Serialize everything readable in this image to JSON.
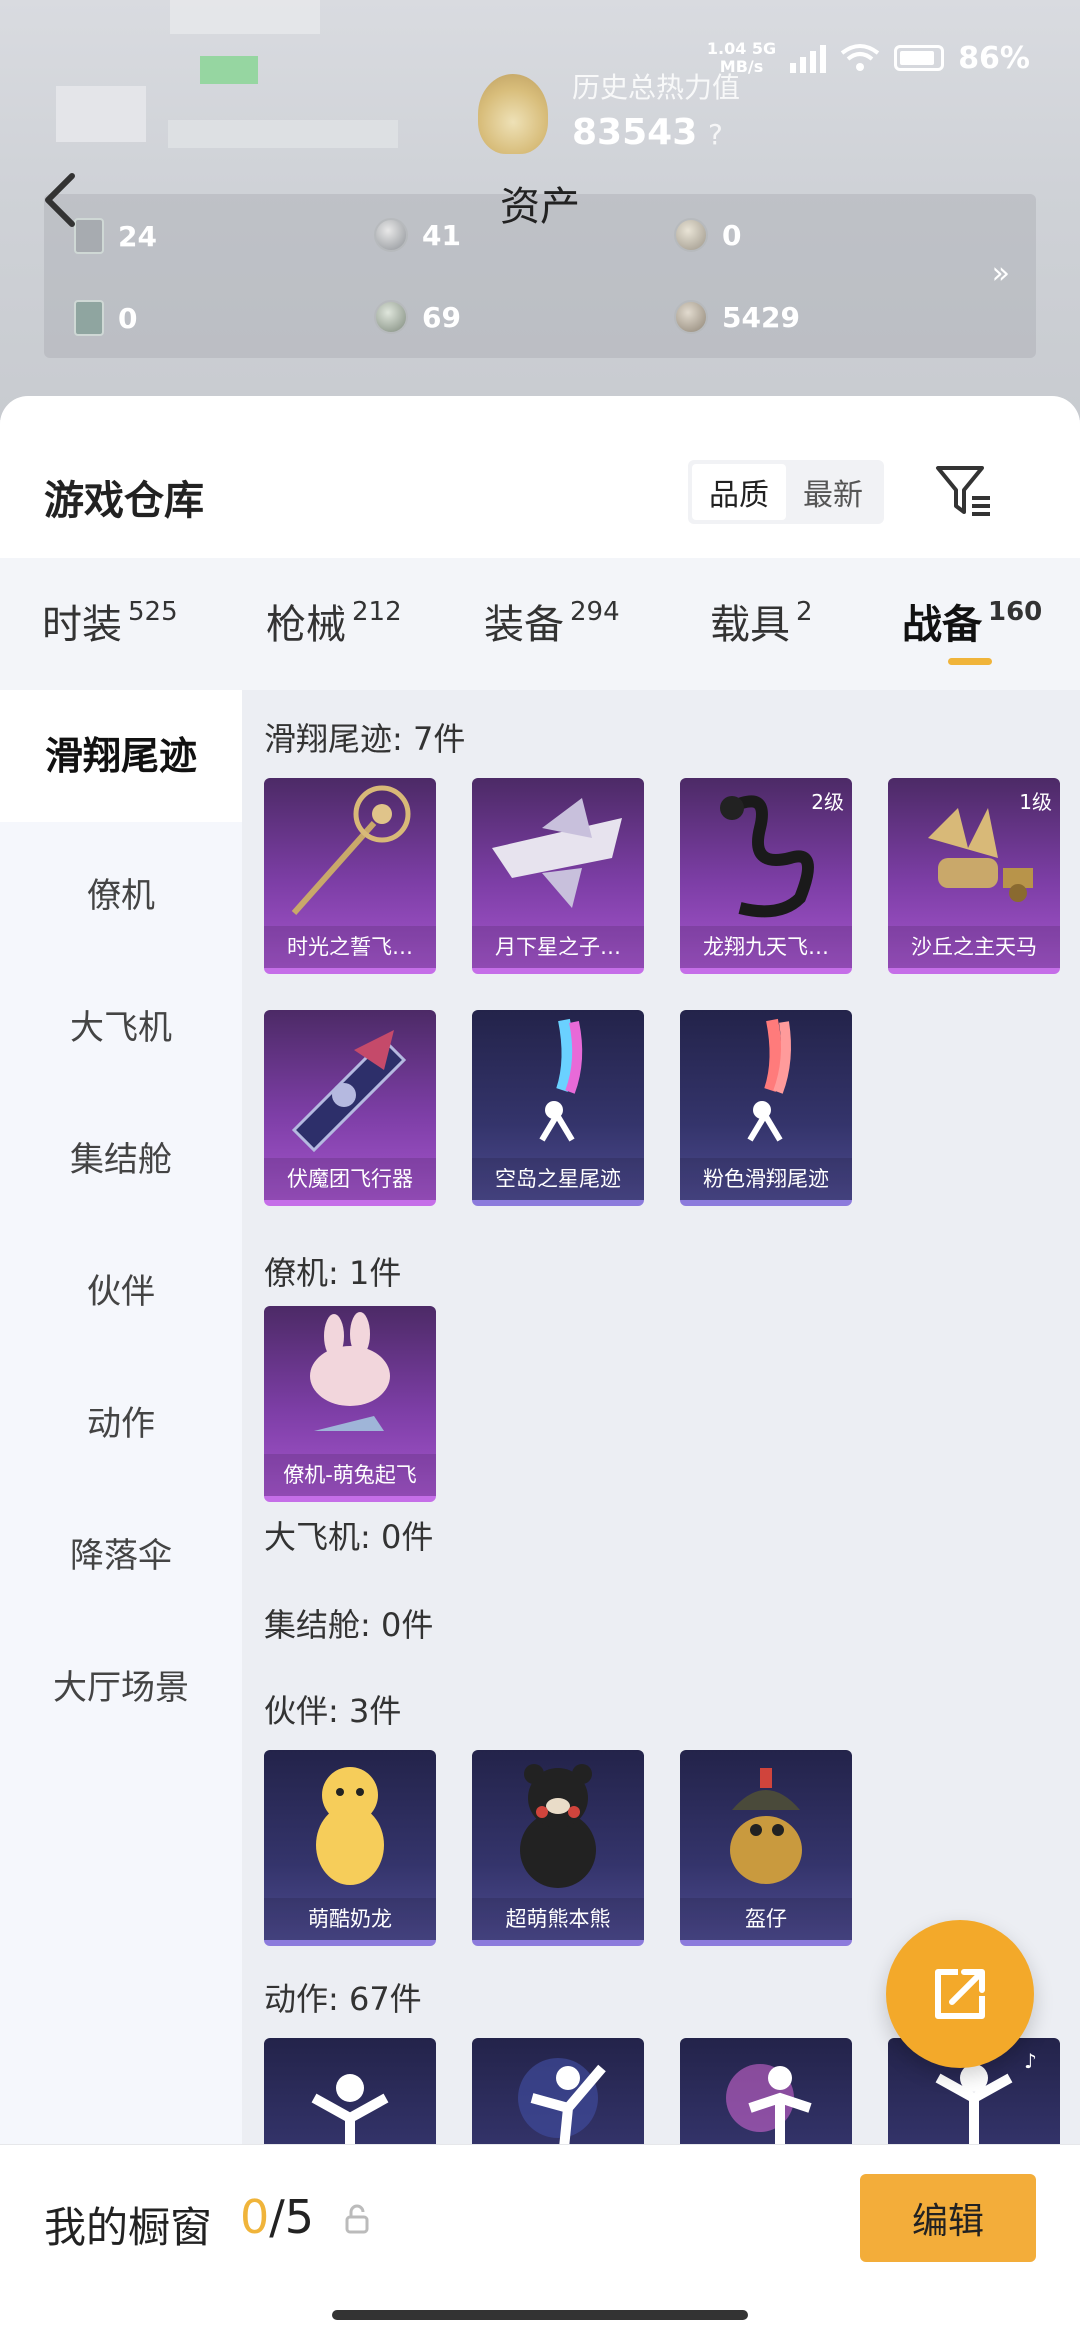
{
  "status_bar": {
    "network_speed": "1.04 5G\nMB/s",
    "battery": "86%"
  },
  "header": {
    "title": "资产",
    "history_label": "历史总热力值",
    "history_value": "83543",
    "help": "?",
    "assets": [
      {
        "icon": "voucher-icon",
        "value": "24"
      },
      {
        "icon": "silver-coin-icon",
        "value": "41"
      },
      {
        "icon": "gold-coin-icon",
        "value": "0"
      },
      {
        "icon": "green-card-icon",
        "value": "0"
      },
      {
        "icon": "coin-icon",
        "value": "69"
      },
      {
        "icon": "bronze-coin-icon",
        "value": "5429"
      }
    ],
    "more": "»"
  },
  "warehouse": {
    "title": "游戏仓库",
    "sort_options": [
      "品质",
      "最新"
    ],
    "sort_selected": "品质"
  },
  "tabs": [
    {
      "label": "时装",
      "count": "525"
    },
    {
      "label": "枪械",
      "count": "212"
    },
    {
      "label": "装备",
      "count": "294"
    },
    {
      "label": "载具",
      "count": "2"
    },
    {
      "label": "战备",
      "count": "160",
      "active": true
    }
  ],
  "sidebar": [
    "滑翔尾迹",
    "僚机",
    "大飞机",
    "集结舱",
    "伙伴",
    "动作",
    "降落伞",
    "大厅场景"
  ],
  "sections": {
    "glide": {
      "title": "滑翔尾迹: 7件",
      "items": [
        {
          "name": "时光之誓飞…",
          "level": ""
        },
        {
          "name": "月下星之子…",
          "level": ""
        },
        {
          "name": "龙翔九天飞…",
          "level": "2级"
        },
        {
          "name": "沙丘之主天马",
          "level": "1级"
        },
        {
          "name": "伏魔团飞行器",
          "level": ""
        },
        {
          "name": "空岛之星尾迹",
          "level": ""
        },
        {
          "name": "粉色滑翔尾迹",
          "level": ""
        }
      ]
    },
    "wingman": {
      "title": "僚机: 1件",
      "items": [
        {
          "name": "僚机-萌兔起飞"
        }
      ]
    },
    "big_plane": {
      "title": "大飞机: 0件"
    },
    "capsule": {
      "title": "集结舱: 0件"
    },
    "partner": {
      "title": "伙伴: 3件",
      "items": [
        {
          "name": "萌酷奶龙"
        },
        {
          "name": "超萌熊本熊"
        },
        {
          "name": "盔仔"
        }
      ]
    },
    "emote": {
      "title": "动作: 67件"
    }
  },
  "showcase": {
    "title": "我的橱窗",
    "current": "0",
    "total": "/5",
    "edit_label": "编辑"
  },
  "colors": {
    "accent": "#f0b43a",
    "purple_rarity": "#c56ee8",
    "blue_rarity": "#8c7bdc"
  }
}
